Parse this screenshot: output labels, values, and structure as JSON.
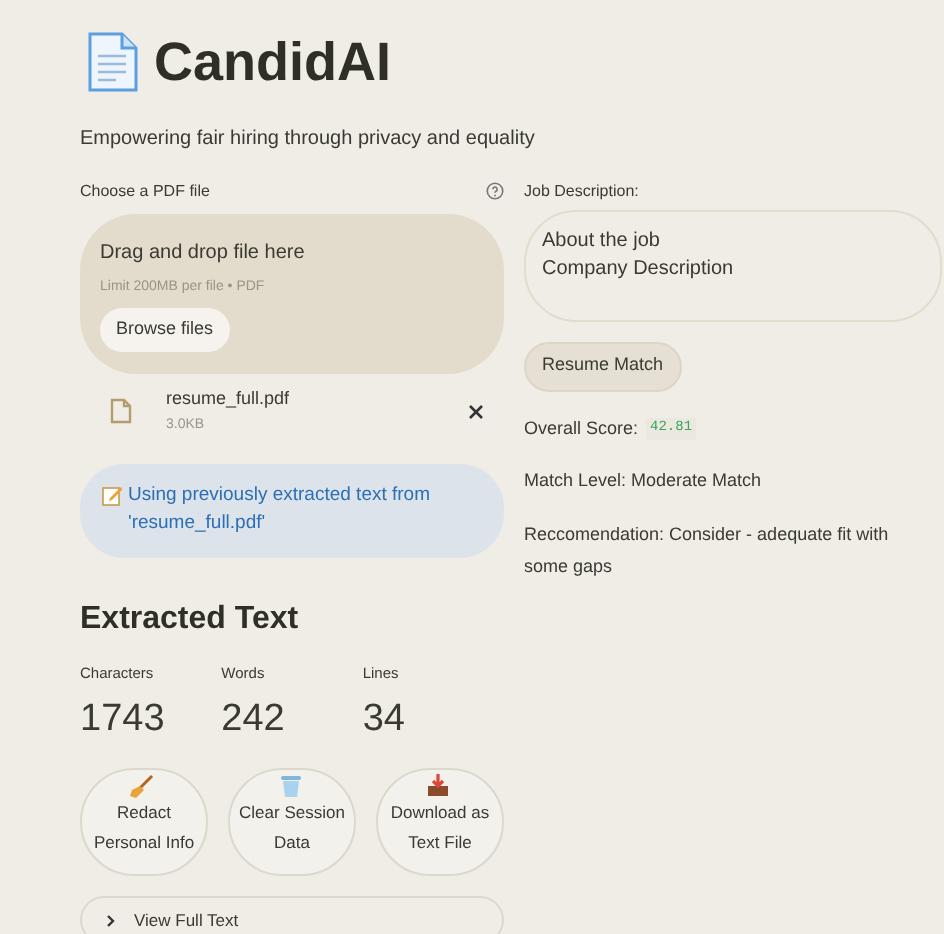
{
  "header": {
    "title": "CandidAI",
    "subtitle": "Empowering fair hiring through privacy and equality"
  },
  "uploader": {
    "label": "Choose a PDF file",
    "dropzone_title": "Drag and drop file here",
    "dropzone_hint": "Limit 200MB per file • PDF",
    "browse_button": "Browse files"
  },
  "file": {
    "name": "resume_full.pdf",
    "size": "3.0KB"
  },
  "info": "Using previously extracted text from 'resume_full.pdf'",
  "extracted": {
    "heading": "Extracted Text",
    "metrics": [
      {
        "label": "Characters",
        "value": "1743"
      },
      {
        "label": "Words",
        "value": "242"
      },
      {
        "label": "Lines",
        "value": "34"
      }
    ],
    "actions": [
      {
        "label": "Redact Personal Info"
      },
      {
        "label": "Clear Session Data"
      },
      {
        "label": "Download as Text File"
      }
    ],
    "expander": "View Full Text"
  },
  "job": {
    "label": "Job Description:",
    "text": "About the job\nCompany Description",
    "button": "Resume Match",
    "score_label": "Overall Score:",
    "score_value": "42.81",
    "match_level": "Match Level: Moderate Match",
    "recommendation": "Reccomendation: Consider - adequate fit with some gaps"
  }
}
